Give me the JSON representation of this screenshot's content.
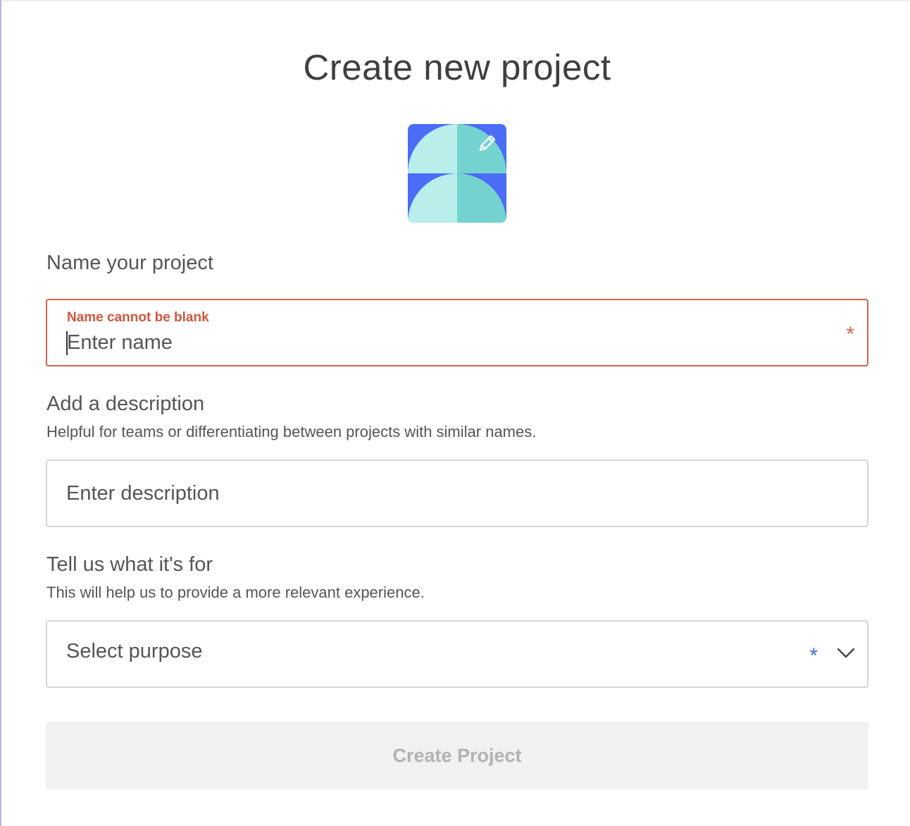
{
  "page": {
    "title": "Create new project"
  },
  "icon": {
    "name": "project-avatar",
    "edit_icon": "pencil-icon",
    "colors": {
      "background": "#4a6cf7",
      "light_teal": "#b9eeeb",
      "teal": "#74d3cf"
    }
  },
  "name_section": {
    "label": "Name your project",
    "error_text": "Name cannot be blank",
    "placeholder": "Enter name",
    "value": "",
    "required_marker": "*",
    "error_color": "#d4634b"
  },
  "description_section": {
    "label": "Add a description",
    "help": "Helpful for teams or differentiating between projects with similar names.",
    "placeholder": "Enter description",
    "value": ""
  },
  "purpose_section": {
    "label": "Tell us what it's for",
    "help": "This will help us to provide a more relevant experience.",
    "selected": "Select purpose",
    "required_marker": "*",
    "required_color": "#3b6fd6",
    "dropdown_icon": "chevron-down-icon"
  },
  "submit": {
    "label": "Create Project",
    "state": "disabled"
  }
}
